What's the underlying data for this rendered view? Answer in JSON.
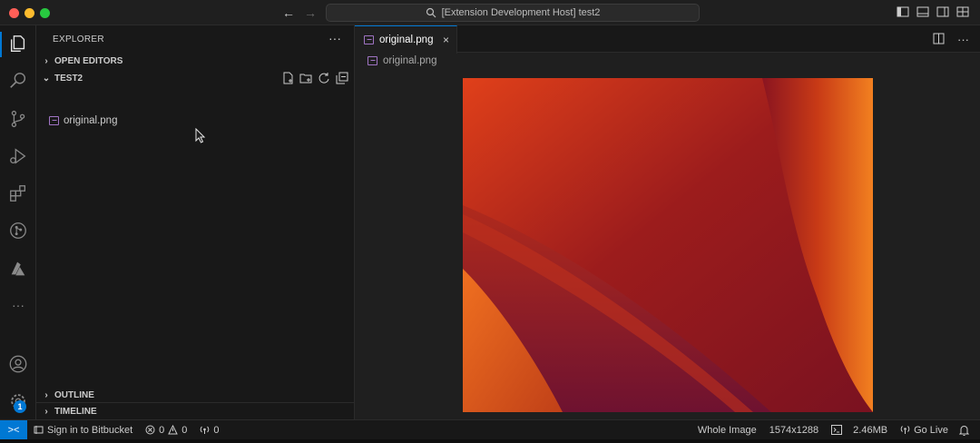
{
  "titlebar": {
    "search_text": "[Extension Development Host] test2"
  },
  "activity_bar": {
    "items": [
      "explorer-icon",
      "search-icon",
      "source-control-icon",
      "run-debug-icon",
      "extensions-icon",
      "git-graph-icon",
      "azure-icon",
      "more-icon",
      "account-icon",
      "settings-icon"
    ],
    "settings_badge": "1"
  },
  "sidebar": {
    "title": "EXPLORER",
    "more": "···",
    "open_editors": "OPEN EDITORS",
    "folder": "TEST2",
    "files": [
      {
        "name": "original.png",
        "icon": "image-file-icon"
      }
    ],
    "outline": "OUTLINE",
    "timeline": "TIMELINE"
  },
  "editor": {
    "tab_label": "original.png",
    "tab_close": "×",
    "breadcrumb_file": "original.png"
  },
  "statusbar": {
    "remote": "><",
    "bitbucket": "Sign in to Bitbucket",
    "errors": "0",
    "warnings": "0",
    "ports": "0",
    "zoom_mode": "Whole Image",
    "dimensions": "1574x1288",
    "size": "2.46MB",
    "go_live": "Go Live"
  },
  "colors": {
    "accent": "#0078d4",
    "background": "#181818",
    "editor_bg": "#1f1f1f"
  }
}
